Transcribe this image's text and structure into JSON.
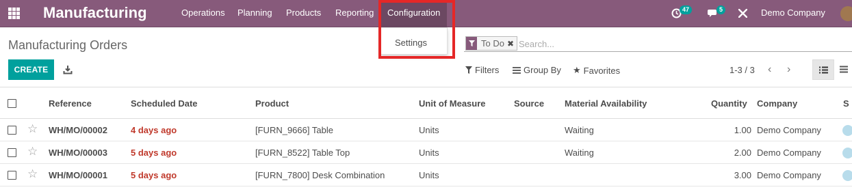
{
  "navbar": {
    "brand": "Manufacturing",
    "menu": [
      "Operations",
      "Planning",
      "Products",
      "Reporting",
      "Configuration"
    ],
    "activity_count": "47",
    "message_count": "5",
    "company": "Demo Company"
  },
  "config_dropdown": {
    "items": [
      "Settings"
    ]
  },
  "control_panel": {
    "title": "Manufacturing Orders",
    "create_label": "CREATE",
    "facet": "To Do",
    "search_placeholder": "Search...",
    "filters_label": "Filters",
    "groupby_label": "Group By",
    "favorites_label": "Favorites",
    "pager": "1-3 / 3"
  },
  "table": {
    "columns": [
      "Reference",
      "Scheduled Date",
      "Product",
      "Unit of Measure",
      "Source",
      "Material Availability",
      "Quantity",
      "Company",
      "S"
    ],
    "rows": [
      {
        "reference": "WH/MO/00002",
        "date": "4 days ago",
        "product": "[FURN_9666] Table",
        "uom": "Units",
        "source": "",
        "availability": "Waiting",
        "quantity": "1.00",
        "company": "Demo Company"
      },
      {
        "reference": "WH/MO/00003",
        "date": "5 days ago",
        "product": "[FURN_8522] Table Top",
        "uom": "Units",
        "source": "",
        "availability": "Waiting",
        "quantity": "2.00",
        "company": "Demo Company"
      },
      {
        "reference": "WH/MO/00001",
        "date": "5 days ago",
        "product": "[FURN_7800] Desk Combination",
        "uom": "Units",
        "source": "",
        "availability": "",
        "quantity": "3.00",
        "company": "Demo Company"
      }
    ]
  },
  "colors": {
    "brand": "#875a7b",
    "accent": "#00a09d",
    "late": "#c0392b",
    "highlight": "#e52727"
  }
}
